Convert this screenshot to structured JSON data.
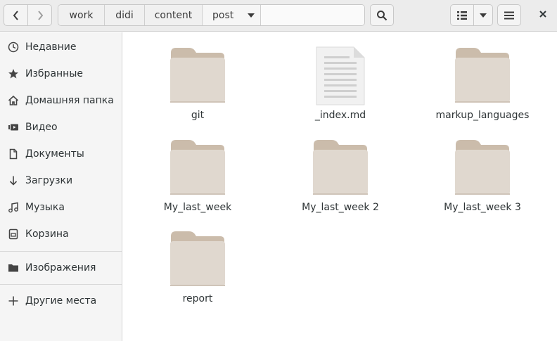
{
  "toolbar": {
    "back_icon": "chevron-left-icon",
    "forward_icon": "chevron-right-icon",
    "search_icon": "search-icon",
    "view_icon": "list-view-icon",
    "menu_icon": "hamburger-menu-icon",
    "close_icon": "close-icon"
  },
  "breadcrumb": {
    "items": [
      "work",
      "didi",
      "content",
      "post"
    ]
  },
  "sidebar": {
    "items": [
      {
        "label": "Недавние",
        "icon": "clock-icon"
      },
      {
        "label": "Избранные",
        "icon": "star-icon"
      },
      {
        "label": "Домашняя папка",
        "icon": "home-icon"
      },
      {
        "label": "Видео",
        "icon": "video-icon"
      },
      {
        "label": "Документы",
        "icon": "document-icon"
      },
      {
        "label": "Загрузки",
        "icon": "download-icon"
      },
      {
        "label": "Музыка",
        "icon": "music-icon"
      },
      {
        "label": "Корзина",
        "icon": "trash-icon"
      },
      {
        "label": "Изображения",
        "icon": "folder-icon"
      },
      {
        "label": "Другие места",
        "icon": "plus-icon"
      }
    ]
  },
  "files": [
    {
      "name": "git",
      "type": "folder"
    },
    {
      "name": "_index.md",
      "type": "text"
    },
    {
      "name": "markup_languages",
      "type": "folder"
    },
    {
      "name": "My_last_week",
      "type": "folder"
    },
    {
      "name": "My_last_week 2",
      "type": "folder"
    },
    {
      "name": "My_last_week 3",
      "type": "folder"
    },
    {
      "name": "report",
      "type": "folder"
    }
  ],
  "colors": {
    "folder_back": "#cbbcab",
    "folder_front": "#e0d8cf",
    "headerbar": "#ececec",
    "sidebar": "#f5f5f5"
  }
}
